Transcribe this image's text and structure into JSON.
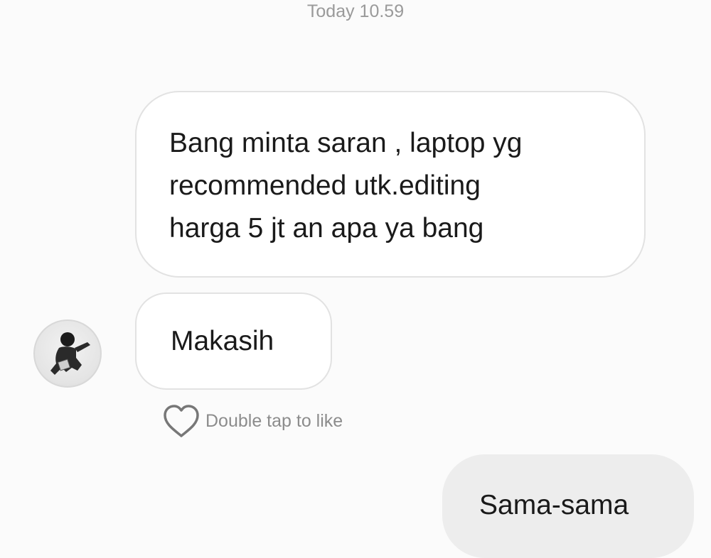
{
  "chat": {
    "timestamp": "Today 10.59",
    "messages": [
      {
        "text": "Bang minta saran , laptop yg\nrecommended utk.editing\nharga 5 jt an apa ya bang"
      },
      {
        "text": "Makasih",
        "avatar_icon": "user-avatar-icon"
      },
      {
        "text": "Sama-sama"
      }
    ],
    "like_hint": "Double tap to like",
    "like_icon": "heart-outline-icon"
  },
  "colors": {
    "background": "#fbfbfb",
    "incoming_bubble": "#ffffff",
    "outgoing_bubble": "#ededed",
    "muted_text": "#9a9a9a"
  }
}
